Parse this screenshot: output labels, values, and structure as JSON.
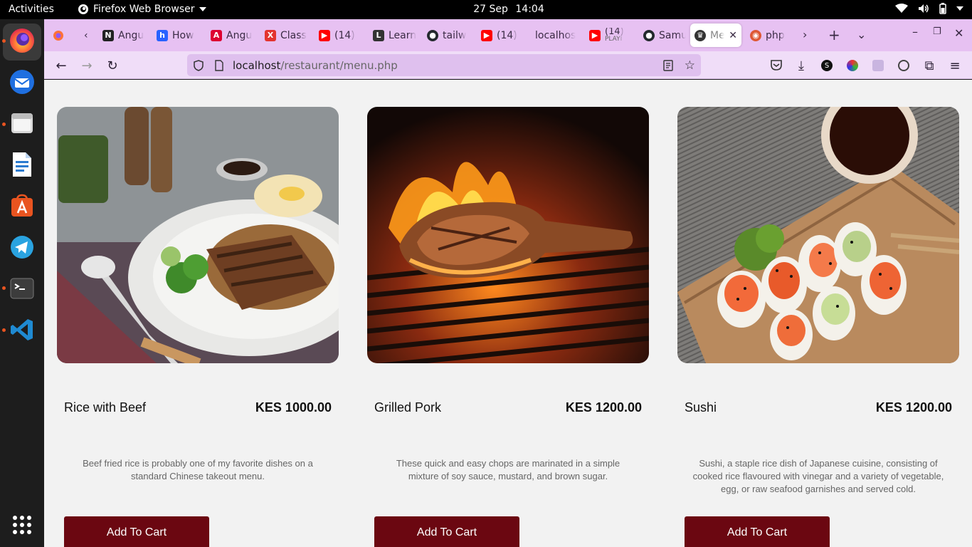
{
  "topbar": {
    "activities": "Activities",
    "app_name": "Firefox Web Browser",
    "date": "27 Sep",
    "time": "14:04",
    "tray_icons": [
      "wifi-icon",
      "volume-icon",
      "battery-icon",
      "power-menu-icon"
    ]
  },
  "dock": {
    "apps": [
      "Firefox",
      "Thunderbird",
      "Files",
      "LibreOffice Writer",
      "Ubuntu Software",
      "Telegram",
      "Terminal",
      "Visual Studio Code",
      "Show Applications"
    ]
  },
  "browser": {
    "tabs": [
      {
        "label": "Angu",
        "icon": "nx-icon",
        "color": "#222222"
      },
      {
        "label": "How",
        "icon": "hashnode-icon",
        "color": "#2962ff"
      },
      {
        "label": "Angu",
        "icon": "angular-icon",
        "color": "#dd0031"
      },
      {
        "label": "Class",
        "icon": "class-icon",
        "color": "#e3342f"
      },
      {
        "label": "(14)",
        "icon": "youtube-icon",
        "color": "#ff0000"
      },
      {
        "label": "Learn",
        "icon": "learn-icon",
        "color": "#333333"
      },
      {
        "label": "tailw",
        "icon": "github-icon",
        "color": "#24292e"
      },
      {
        "label": "(14)",
        "icon": "youtube-icon",
        "color": "#ff0000"
      },
      {
        "label": "localhos",
        "icon": "",
        "color": ""
      },
      {
        "label": "(14)",
        "sub": "PLAYI",
        "icon": "youtube-icon",
        "color": "#ff0000"
      },
      {
        "label": "Samu",
        "icon": "github-icon",
        "color": "#24292e"
      },
      {
        "label": "Me",
        "icon": "chef-icon",
        "color": "#333333"
      },
      {
        "label": "php",
        "icon": "duckduckgo-icon",
        "color": "#de5833"
      }
    ],
    "url_host": "localhost",
    "url_path": "/restaurant/menu.php"
  },
  "menu": [
    {
      "name": "Rice with Beef",
      "price": "KES 1000.00",
      "description": "Beef fried rice is probably one of my favorite dishes on a standard Chinese takeout menu.",
      "button": "Add To Cart"
    },
    {
      "name": "Grilled Pork",
      "price": "KES 1200.00",
      "description": "These quick and easy chops are marinated in a simple mixture of soy sauce, mustard, and brown sugar.",
      "button": "Add To Cart"
    },
    {
      "name": "Sushi",
      "price": "KES 1200.00",
      "description": "Sushi, a staple rice dish of Japanese cuisine, consisting of cooked rice flavoured with vinegar and a variety of vegetable, egg, or raw seafood garnishes and served cold.",
      "button": "Add To Cart"
    }
  ],
  "colors": {
    "cart_button": "#6b0711",
    "tabstrip": "#e7c1f2",
    "navbar": "#f0ddf8",
    "page_bg": "#f2f2f2"
  }
}
